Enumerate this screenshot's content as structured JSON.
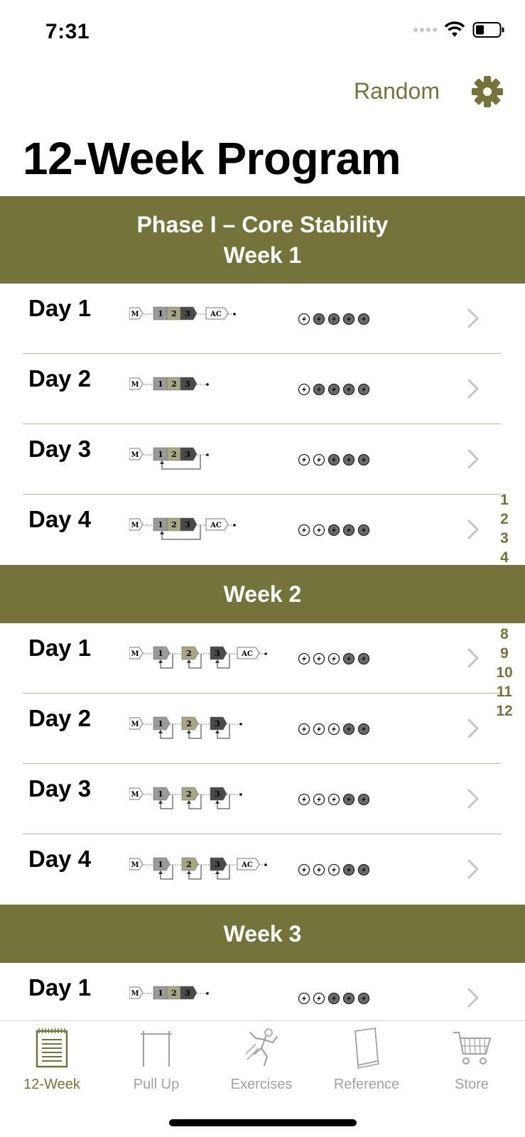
{
  "status": {
    "time": "7:31"
  },
  "header": {
    "random_label": "Random",
    "title": "12-Week Program"
  },
  "colors": {
    "accent": "#74743a",
    "gray_light": "#9a9a9a",
    "olive_light": "#a8a784",
    "gray_dark": "#4a4a4a"
  },
  "sections": [
    {
      "title_line1": "Phase I – Core Stability",
      "title_line2": "Week 1",
      "days": [
        {
          "label": "Day 1",
          "diagram": "linear",
          "ac": true,
          "loop": false,
          "filled": 4
        },
        {
          "label": "Day 2",
          "diagram": "linear",
          "ac": false,
          "loop": false,
          "filled": 4
        },
        {
          "label": "Day 3",
          "diagram": "linear",
          "ac": false,
          "loop": true,
          "filled": 3
        },
        {
          "label": "Day 4",
          "diagram": "linear",
          "ac": true,
          "loop": true,
          "filled": 3
        }
      ]
    },
    {
      "title_line1": "Week 2",
      "days": [
        {
          "label": "Day 1",
          "diagram": "split",
          "ac": true,
          "filled": 2
        },
        {
          "label": "Day 2",
          "diagram": "split",
          "ac": false,
          "filled": 2
        },
        {
          "label": "Day 3",
          "diagram": "split",
          "ac": false,
          "filled": 2
        },
        {
          "label": "Day 4",
          "diagram": "split",
          "ac": true,
          "filled": 2
        }
      ]
    },
    {
      "title_line1": "Week 3",
      "days": [
        {
          "label": "Day 1",
          "diagram": "linear",
          "ac": false,
          "loop": false,
          "filled": 3
        }
      ]
    }
  ],
  "diagram_text": {
    "m": "M",
    "s1": "1",
    "s2": "2",
    "s3": "3",
    "ac": "AC"
  },
  "index_bar": {
    "top": [
      "1",
      "2",
      "3",
      "4"
    ],
    "bottom": [
      "8",
      "9",
      "10",
      "11",
      "12"
    ]
  },
  "tabs": [
    {
      "label": "12-Week",
      "icon": "notepad-icon",
      "active": true
    },
    {
      "label": "Pull Up",
      "icon": "pullup-bar-icon",
      "active": false
    },
    {
      "label": "Exercises",
      "icon": "climber-icon",
      "active": false
    },
    {
      "label": "Reference",
      "icon": "book-icon",
      "active": false
    },
    {
      "label": "Store",
      "icon": "cart-icon",
      "active": false
    }
  ]
}
